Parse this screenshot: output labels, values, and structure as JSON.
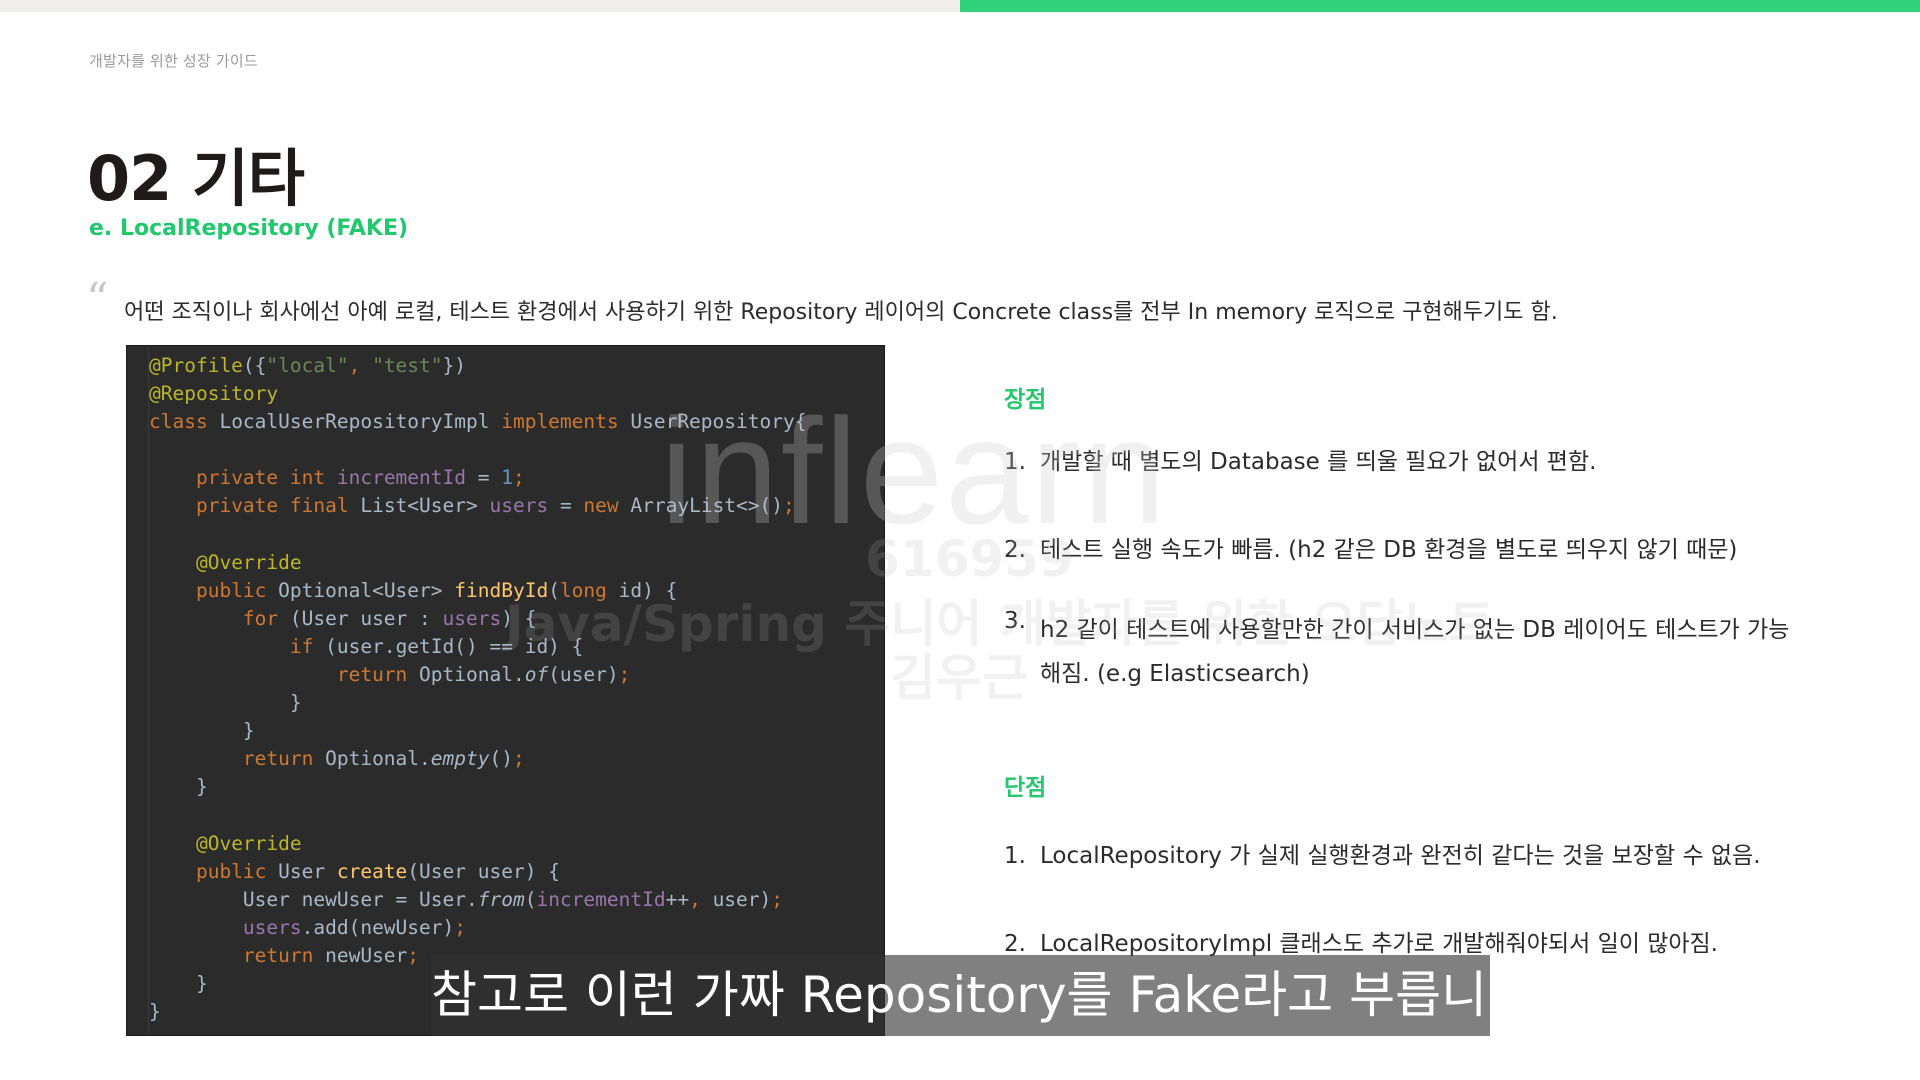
{
  "progress": {
    "fraction": 0.5,
    "fill_color": "#2fd27a"
  },
  "header": {
    "course_label": "개발자를 위한 성장 가이드",
    "title": "02 기타",
    "subtitle": "e. LocalRepository (FAKE)"
  },
  "quote": {
    "mark": "“",
    "text": "어떤 조직이나 회사에선 아예 로컬, 테스트 환경에서 사용하기 위한 Repository 레이어의 Concrete class를 전부 In memory 로직으로 구현해두기도 함."
  },
  "pros": {
    "heading": "장점",
    "items": [
      {
        "num": "1.",
        "text": "개발할 때 별도의 Database 를 띄울 필요가 없어서 편함."
      },
      {
        "num": "2.",
        "text": "테스트 실행 속도가 빠름. (h2 같은 DB 환경을 별도로 띄우지 않기 때문)"
      },
      {
        "num": "3.",
        "text": "h2 같이 테스트에 사용할만한 간이 서비스가 없는 DB 레이어도 테스트가 가능해짐. (e.g Elasticsearch)"
      }
    ]
  },
  "cons": {
    "heading": "단점",
    "items": [
      {
        "num": "1.",
        "text": "LocalRepository 가 실제 실행환경과 완전히 같다는 것을 보장할 수 없음."
      },
      {
        "num": "2.",
        "text": "LocalRepositoryImpl 클래스도 추가로 개발해줘야되서 일이 많아짐."
      }
    ]
  },
  "code": {
    "lines": [
      [
        [
          "ann",
          "@Profile"
        ],
        [
          "",
          "({"
        ],
        [
          "str",
          "\"local\""
        ],
        [
          "kw",
          ", "
        ],
        [
          "str",
          "\"test\""
        ],
        [
          "",
          "})"
        ]
      ],
      [
        [
          "ann",
          "@Repository"
        ]
      ],
      [
        [
          "kw",
          "class "
        ],
        [
          "",
          "LocalUserRepositoryImpl "
        ],
        [
          "kw",
          "implements "
        ],
        [
          "",
          "UserRepository{"
        ]
      ],
      [],
      [
        [
          "",
          "    "
        ],
        [
          "kw",
          "private int "
        ],
        [
          "fld",
          "incrementId "
        ],
        [
          "",
          "= "
        ],
        [
          "num",
          "1"
        ],
        [
          "kw",
          ";"
        ]
      ],
      [
        [
          "",
          "    "
        ],
        [
          "kw",
          "private final "
        ],
        [
          "",
          "List<User> "
        ],
        [
          "fld",
          "users "
        ],
        [
          "",
          "= "
        ],
        [
          "kw",
          "new "
        ],
        [
          "",
          "ArrayList<>()"
        ],
        [
          "kw",
          ";"
        ]
      ],
      [],
      [
        [
          "",
          "    "
        ],
        [
          "ann",
          "@Override"
        ]
      ],
      [
        [
          "",
          "    "
        ],
        [
          "kw",
          "public "
        ],
        [
          "",
          "Optional<User> "
        ],
        [
          "fn",
          "findById"
        ],
        [
          "",
          "("
        ],
        [
          "kw",
          "long "
        ],
        [
          "",
          "id) {"
        ]
      ],
      [
        [
          "",
          "        "
        ],
        [
          "kw",
          "for "
        ],
        [
          "",
          "(User user : "
        ],
        [
          "fld",
          "users"
        ],
        [
          "",
          ") {"
        ]
      ],
      [
        [
          "",
          "            "
        ],
        [
          "kw",
          "if "
        ],
        [
          "",
          "(user.getId() == id) {"
        ]
      ],
      [
        [
          "",
          "                "
        ],
        [
          "kw",
          "return "
        ],
        [
          "",
          "Optional."
        ],
        [
          "it",
          "of"
        ],
        [
          "",
          "(user)"
        ],
        [
          "kw",
          ";"
        ]
      ],
      [
        [
          "",
          "            }"
        ]
      ],
      [
        [
          "",
          "        }"
        ]
      ],
      [
        [
          "",
          "        "
        ],
        [
          "kw",
          "return "
        ],
        [
          "",
          "Optional."
        ],
        [
          "it",
          "empty"
        ],
        [
          "",
          "()"
        ],
        [
          "kw",
          ";"
        ]
      ],
      [
        [
          "",
          "    }"
        ]
      ],
      [],
      [
        [
          "",
          "    "
        ],
        [
          "ann",
          "@Override"
        ]
      ],
      [
        [
          "",
          "    "
        ],
        [
          "kw",
          "public "
        ],
        [
          "",
          "User "
        ],
        [
          "fn",
          "create"
        ],
        [
          "",
          "(User user) {"
        ]
      ],
      [
        [
          "",
          "        User newUser = User."
        ],
        [
          "it",
          "from"
        ],
        [
          "",
          "("
        ],
        [
          "fld",
          "incrementId"
        ],
        [
          "",
          "++"
        ],
        [
          "kw",
          ", "
        ],
        [
          "",
          "user)"
        ],
        [
          "kw",
          ";"
        ]
      ],
      [
        [
          "",
          "        "
        ],
        [
          "fld",
          "users"
        ],
        [
          "",
          ".add(newUser)"
        ],
        [
          "kw",
          ";"
        ]
      ],
      [
        [
          "",
          "        "
        ],
        [
          "kw",
          "return "
        ],
        [
          "",
          "newUser"
        ],
        [
          "kw",
          ";"
        ]
      ],
      [
        [
          "",
          "    }"
        ]
      ],
      [
        [
          "",
          "}"
        ]
      ]
    ]
  },
  "watermark": {
    "logo": "inflearn",
    "id": "616959",
    "course": "Java/Spring 주니어 개발자를 위한 오답노트",
    "name": "김우근"
  },
  "caption": "참고로 이런 가짜 Repository를 Fake라고 부릅니다"
}
